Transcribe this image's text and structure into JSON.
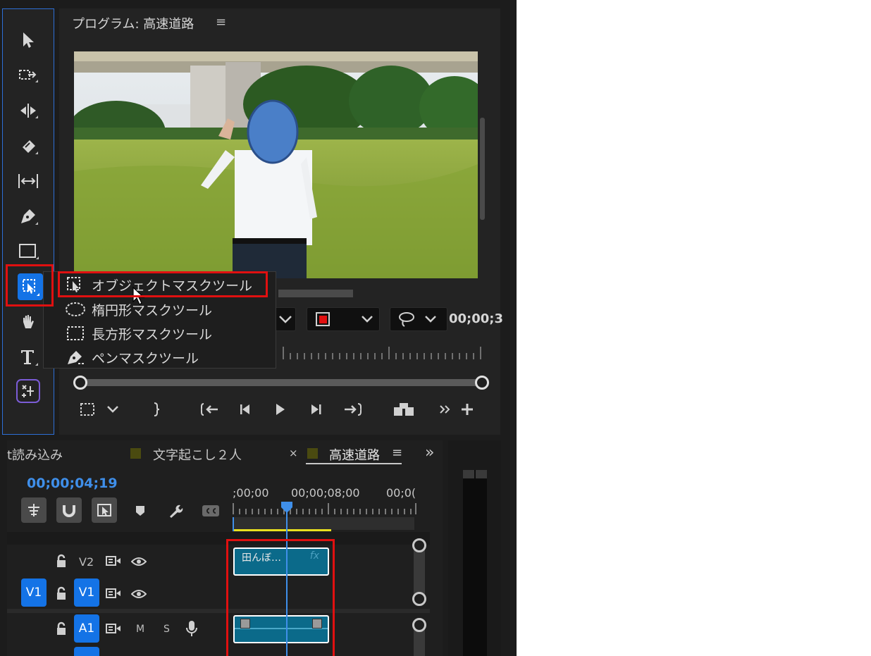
{
  "program_monitor": {
    "title": "プログラム: 高速道路",
    "menu_icon": "≡",
    "timecode_partial": "00;00;3"
  },
  "tools": [
    {
      "name": "selection-tool-icon"
    },
    {
      "name": "track-select-tool-icon"
    },
    {
      "name": "ripple-edit-tool-icon"
    },
    {
      "name": "razor-tool-icon"
    },
    {
      "name": "slip-tool-icon"
    },
    {
      "name": "pen-tool-icon"
    },
    {
      "name": "rectangle-tool-icon"
    },
    {
      "name": "object-mask-tool-icon",
      "active": true
    },
    {
      "name": "hand-tool-icon"
    },
    {
      "name": "type-tool-icon"
    },
    {
      "name": "generative-tool-icon"
    }
  ],
  "mask_menu": {
    "items": [
      {
        "label": "オブジェクトマスクツール",
        "icon": "object-mask-icon",
        "highlighted": true
      },
      {
        "label": "楕円形マスクツール",
        "icon": "ellipse-mask-icon"
      },
      {
        "label": "長方形マスクツール",
        "icon": "rectangle-mask-icon"
      },
      {
        "label": "ペンマスクツール",
        "icon": "pen-mask-icon"
      }
    ]
  },
  "timeline": {
    "tabs": [
      {
        "label": "t読み込み"
      },
      {
        "label": "文字起こし２人"
      },
      {
        "label": "高速道路",
        "active": true,
        "close": "×",
        "menu": "≡"
      }
    ],
    "more": "»",
    "timecode": "00;00;04;19",
    "ruler_labels": [
      ";00;00",
      "00;00;08;00",
      "00;0("
    ],
    "tracks": {
      "v2": {
        "label": "V2"
      },
      "v1": {
        "source": "V1",
        "label": "V1"
      },
      "a1": {
        "label": "A1",
        "m": "M",
        "s": "S"
      }
    },
    "clip_v2": {
      "name": "田んぼ…",
      "fx": "fx"
    }
  },
  "colors": {
    "accent": "#1473e6",
    "highlight_box": "#e01010",
    "clip": "#0b6a8a",
    "timecode": "#3f8fea"
  }
}
